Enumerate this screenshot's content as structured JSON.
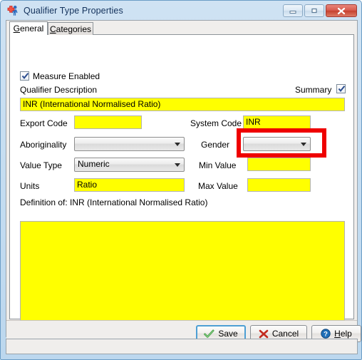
{
  "window": {
    "title": "Qualifier Type Properties",
    "icon": "medical-cross-person-icon",
    "minimize_label": "Minimize",
    "maximize_label": "Maximize",
    "close_label": "Close"
  },
  "tabs": [
    {
      "label": "General",
      "accel": "G",
      "rest": "eneral",
      "active": true
    },
    {
      "label": "Categories",
      "accel": "C",
      "rest": "ategories",
      "active": false
    }
  ],
  "form": {
    "measure_enabled": {
      "label": "Measure Enabled",
      "checked": true
    },
    "summary": {
      "label": "Summary",
      "checked": true
    },
    "qualifier_description": {
      "label": "Qualifier Description",
      "value": "INR (International Normalised Ratio)"
    },
    "export_code": {
      "label": "Export Code",
      "value": ""
    },
    "system_code": {
      "label": "System Code",
      "value": "INR",
      "highlighted": true
    },
    "aboriginality": {
      "label": "Aboriginality",
      "value": ""
    },
    "gender": {
      "label": "Gender",
      "value": ""
    },
    "value_type": {
      "label": "Value Type",
      "value": "Numeric"
    },
    "min_value": {
      "label": "Min Value",
      "value": ""
    },
    "units": {
      "label": "Units",
      "value": "Ratio"
    },
    "max_value": {
      "label": "Max Value",
      "value": ""
    },
    "definition": {
      "label": "Definition of: INR (International Normalised Ratio)",
      "value": ""
    }
  },
  "buttons": {
    "save": {
      "label": "Save",
      "icon": "green-check-icon",
      "default": true
    },
    "cancel": {
      "label": "Cancel",
      "accel": "",
      "icon": "red-x-icon"
    },
    "help": {
      "label": "Help",
      "accel": "H",
      "rest": "elp",
      "icon": "blue-question-icon"
    }
  },
  "status": {
    "text": ""
  },
  "colors": {
    "field_yellow": "#ffff00",
    "highlight_red": "#ef0000",
    "title_text": "#13325c",
    "window_frame": "#c3dcf0"
  }
}
